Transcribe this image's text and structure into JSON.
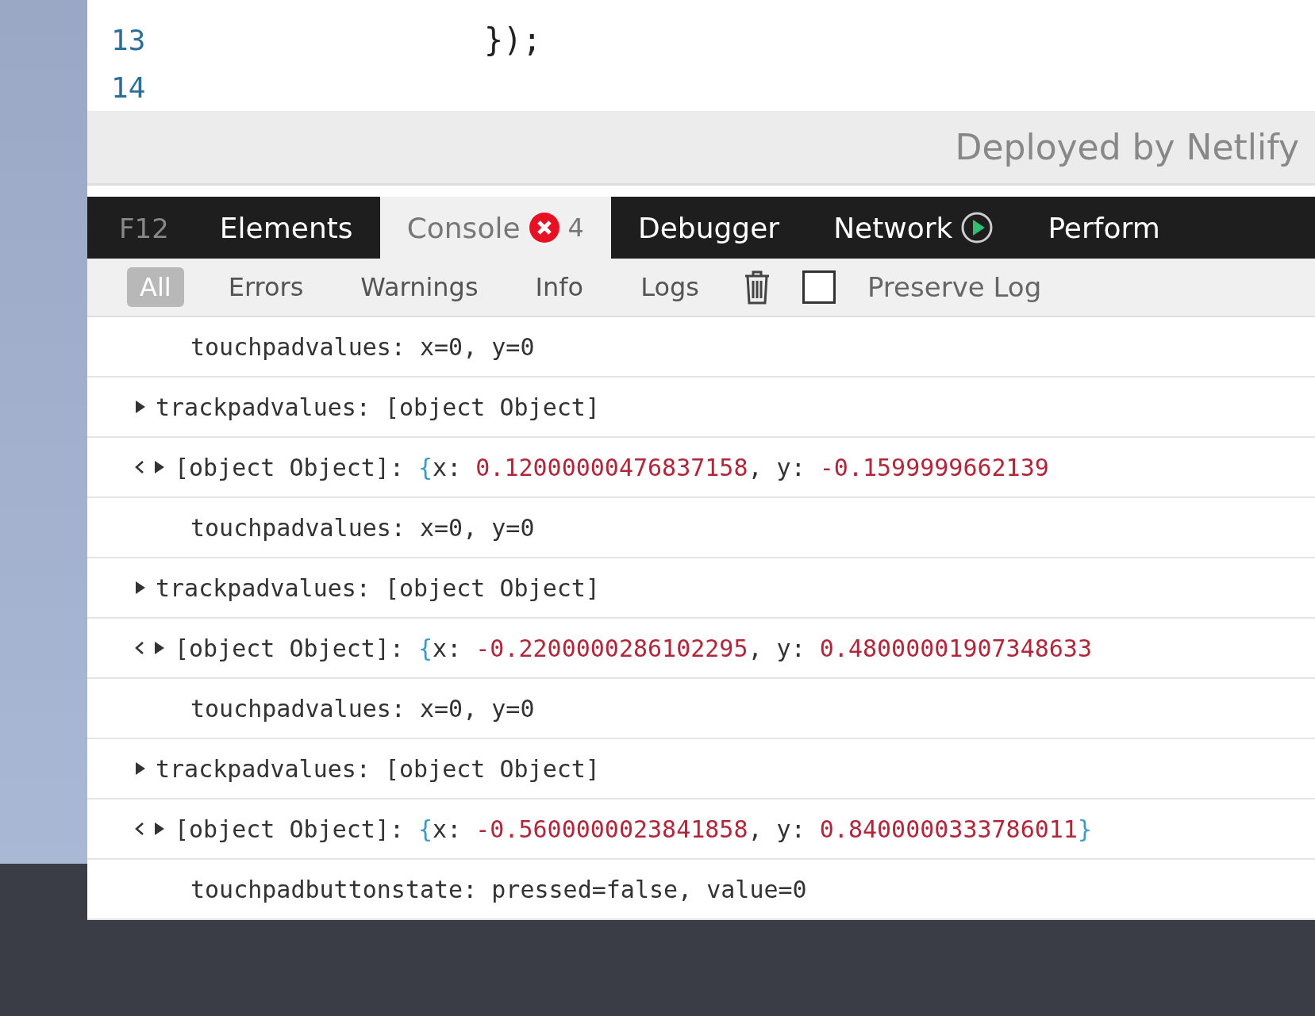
{
  "editor": {
    "lines": [
      {
        "number": "13",
        "code": "});"
      },
      {
        "number": "14"
      }
    ]
  },
  "footer": {
    "text": "Deployed by Netlify"
  },
  "devtools": {
    "label": "F12",
    "tabs": [
      {
        "label": "Elements",
        "selected": false
      },
      {
        "label": "Console",
        "selected": true,
        "badge": "4"
      },
      {
        "label": "Debugger",
        "selected": false
      },
      {
        "label": "Network",
        "selected": false,
        "kind": "play"
      },
      {
        "label": "Perform",
        "selected": false
      }
    ],
    "filters": [
      {
        "label": "All",
        "selected": true
      },
      {
        "label": "Errors",
        "selected": false
      },
      {
        "label": "Warnings",
        "selected": false
      },
      {
        "label": "Info",
        "selected": false
      },
      {
        "label": "Logs",
        "selected": false
      }
    ],
    "preserve_log": {
      "label": "Preserve Log",
      "checked": false
    },
    "console": [
      {
        "kind": "log",
        "text": "touchpadvalues: x=0, y=0"
      },
      {
        "kind": "object",
        "text": "trackpadvalues: [object Object]"
      },
      {
        "kind": "result",
        "segments": [
          {
            "kind": "plain",
            "text": "[object Object]: "
          },
          {
            "kind": "brace",
            "text": "{"
          },
          {
            "kind": "plain",
            "text": "x: "
          },
          {
            "kind": "number",
            "text": "0.12000000476837158"
          },
          {
            "kind": "plain",
            "text": ", y: "
          },
          {
            "kind": "number",
            "text": "-0.1599999662139"
          }
        ]
      },
      {
        "kind": "log",
        "text": "touchpadvalues: x=0, y=0"
      },
      {
        "kind": "object",
        "text": "trackpadvalues: [object Object]"
      },
      {
        "kind": "result",
        "segments": [
          {
            "kind": "plain",
            "text": "[object Object]: "
          },
          {
            "kind": "brace",
            "text": "{"
          },
          {
            "kind": "plain",
            "text": "x: "
          },
          {
            "kind": "number",
            "text": "-0.2200000286102295"
          },
          {
            "kind": "plain",
            "text": ", y: "
          },
          {
            "kind": "number",
            "text": "0.48000001907348633"
          }
        ]
      },
      {
        "kind": "log",
        "text": "touchpadvalues: x=0, y=0"
      },
      {
        "kind": "object",
        "text": "trackpadvalues: [object Object]"
      },
      {
        "kind": "result",
        "segments": [
          {
            "kind": "plain",
            "text": "[object Object]: "
          },
          {
            "kind": "brace",
            "text": "{"
          },
          {
            "kind": "plain",
            "text": "x: "
          },
          {
            "kind": "number",
            "text": "-0.5600000023841858"
          },
          {
            "kind": "plain",
            "text": ", y: "
          },
          {
            "kind": "number",
            "text": "0.8400000333786011"
          },
          {
            "kind": "brace",
            "text": "}"
          }
        ]
      },
      {
        "kind": "log",
        "text": "touchpadbuttonstate: pressed=false, value=0"
      }
    ]
  }
}
